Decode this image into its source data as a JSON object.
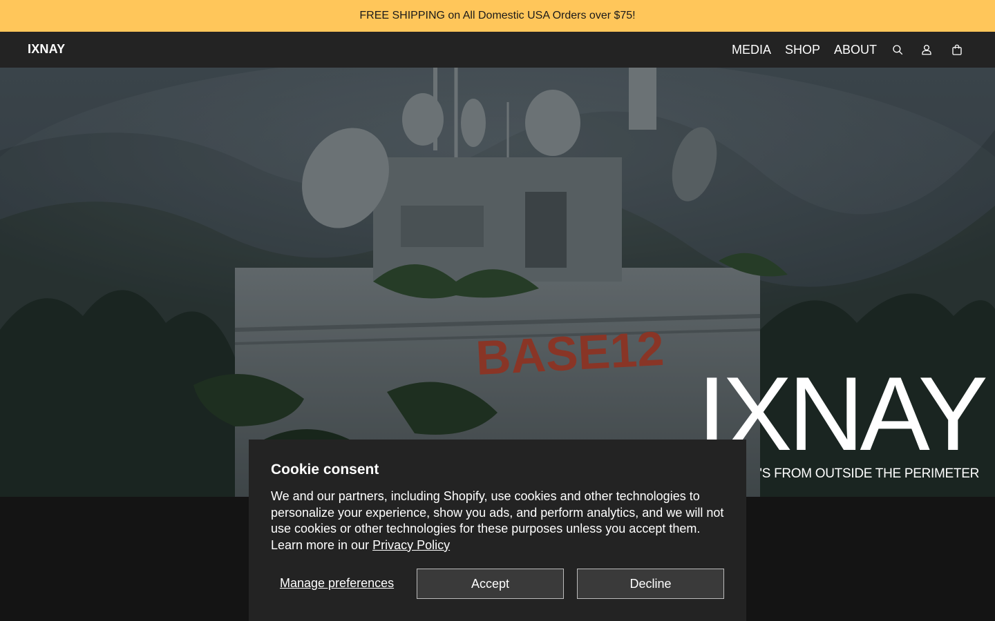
{
  "announcement": {
    "text": "FREE SHIPPING on All Domestic USA Orders over $75!"
  },
  "header": {
    "logo": "IXNAY",
    "nav": [
      {
        "label": "MEDIA"
      },
      {
        "label": "SHOP"
      },
      {
        "label": "ABOUT"
      }
    ],
    "icons": [
      "search-icon",
      "account-icon",
      "cart-icon"
    ]
  },
  "hero": {
    "title": "IXNAY",
    "subtitle": "'S FROM OUTSIDE THE PERIMETER",
    "image_label": "BASE12"
  },
  "cookie": {
    "title": "Cookie consent",
    "body": "We and our partners, including Shopify, use cookies and other technologies to personalize your experience, show you ads, and perform analytics, and we will not use cookies or other technologies for these purposes unless you accept them. Learn more in our ",
    "privacy_link": "Privacy Policy",
    "manage_label": "Manage preferences",
    "accept_label": "Accept",
    "decline_label": "Decline"
  },
  "colors": {
    "announcement_bg": "#ffc65a",
    "header_bg": "#232323",
    "page_bg": "#141414",
    "base_text": "#b3402b"
  }
}
